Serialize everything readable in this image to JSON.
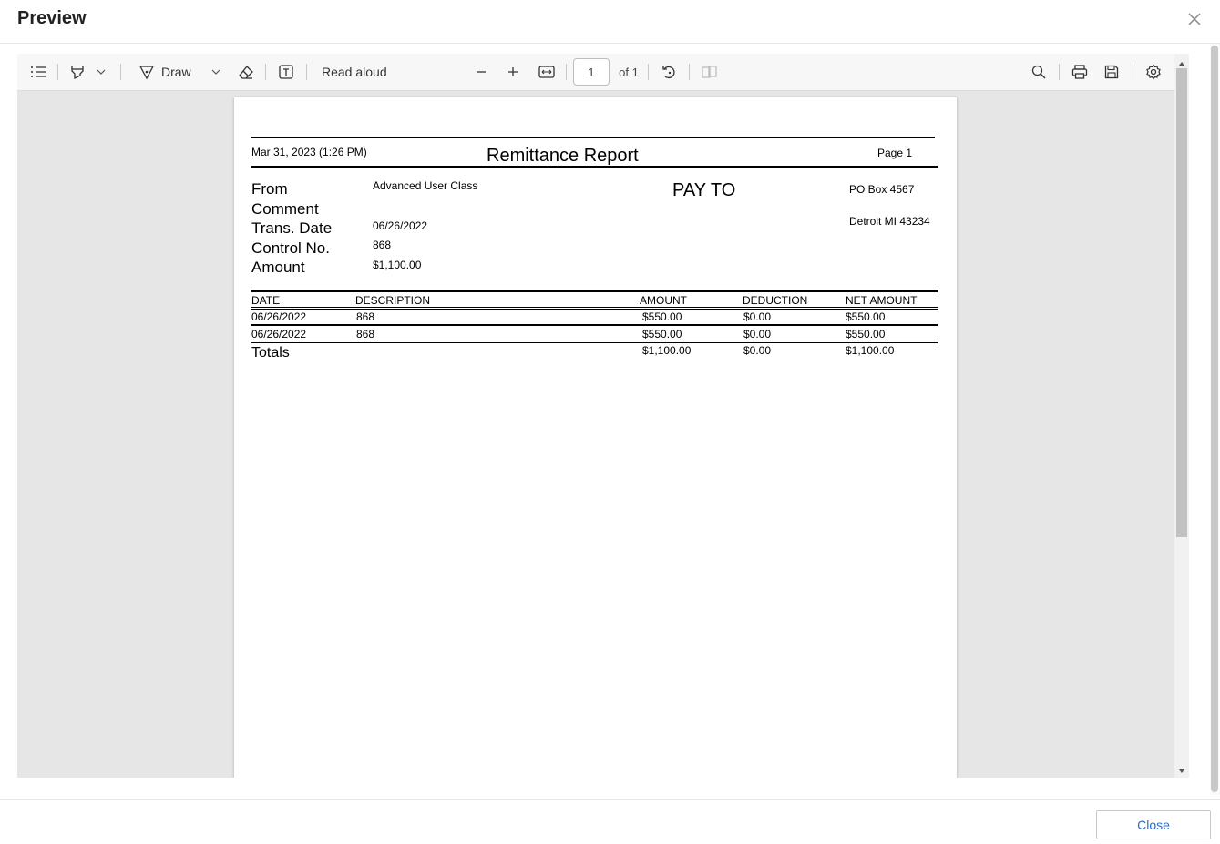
{
  "dialog": {
    "title": "Preview",
    "close_label": "Close"
  },
  "toolbar": {
    "draw_label": "Draw",
    "read_aloud_label": "Read aloud",
    "page_number": "1",
    "page_count": "of 1"
  },
  "report": {
    "timestamp": "Mar 31, 2023 (1:26 PM)",
    "title": "Remittance Report",
    "page_label": "Page 1",
    "labels": {
      "from": "From",
      "comment": "Comment",
      "trans_date": "Trans. Date",
      "control_no": "Control No.",
      "amount": "Amount"
    },
    "values": {
      "from": "Advanced User Class",
      "trans_date": "06/26/2022",
      "control_no": "868",
      "amount": "$1,100.00"
    },
    "pay_to": {
      "heading": "PAY TO",
      "line1": "PO Box 4567",
      "line2": "Detroit MI 43234"
    },
    "table": {
      "headers": [
        "DATE",
        "DESCRIPTION",
        "AMOUNT",
        "DEDUCTION",
        "NET AMOUNT"
      ],
      "rows": [
        [
          "06/26/2022",
          "868",
          "$550.00",
          "$0.00",
          "$550.00"
        ],
        [
          "06/26/2022",
          "868",
          "$550.00",
          "$0.00",
          "$550.00"
        ]
      ],
      "totals": {
        "label": "Totals",
        "amount": "$1,100.00",
        "deduction": "$0.00",
        "net": "$1,100.00"
      }
    }
  },
  "icons": {
    "toc": "list-icon",
    "highlight": "highlighter-icon",
    "draw": "pen-icon",
    "erase": "eraser-icon",
    "text": "text-box-icon",
    "zoom_out": "minus-icon",
    "zoom_in": "plus-icon",
    "fit": "fit-width-icon",
    "rotate": "rotate-icon",
    "two_page": "two-page-icon",
    "search": "search-icon",
    "print": "print-icon",
    "save": "save-icon",
    "settings": "gear-icon"
  }
}
